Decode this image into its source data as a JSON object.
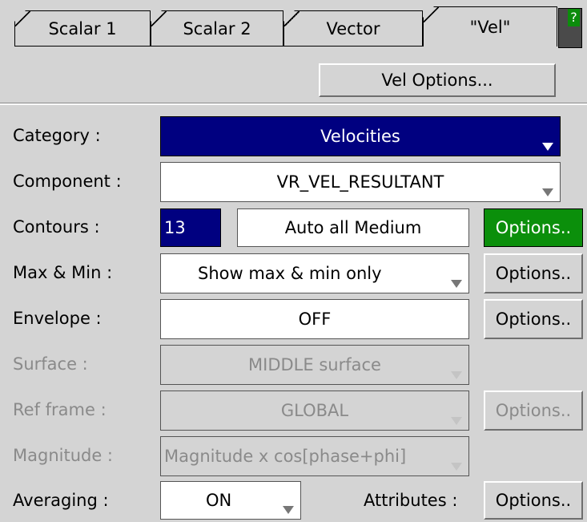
{
  "tabs": [
    {
      "label": "Scalar 1"
    },
    {
      "label": "Scalar 2"
    },
    {
      "label": "Vector"
    },
    {
      "label": "\"Vel\""
    }
  ],
  "help": {
    "label": "?"
  },
  "vel_options": {
    "label": "Vel Options..."
  },
  "rows": {
    "category": {
      "label": "Category :",
      "value": "Velocities"
    },
    "component": {
      "label": "Component :",
      "value": "VR_VEL_RESULTANT"
    },
    "contours": {
      "label": "Contours :",
      "count": "13",
      "mode": "Auto all Medium",
      "options": "Options.."
    },
    "maxmin": {
      "label": "Max & Min :",
      "value": "Show max & min only",
      "options": "Options.."
    },
    "envelope": {
      "label": "Envelope :",
      "value": "OFF",
      "options": "Options.."
    },
    "surface": {
      "label": "Surface :",
      "value": "MIDDLE surface"
    },
    "ref_frame": {
      "label": "Ref frame :",
      "value": "GLOBAL",
      "options": "Options.."
    },
    "magnitude": {
      "label": "Magnitude :",
      "value": "Magnitude x cos[phase+phi]"
    },
    "averaging": {
      "label": "Averaging :",
      "value": "ON"
    },
    "attributes": {
      "label": "Attributes :",
      "options": "Options.."
    }
  },
  "colors": {
    "background": "#d4d4d4",
    "selected_blue": "#000080",
    "active_green": "#0b8f0b"
  }
}
